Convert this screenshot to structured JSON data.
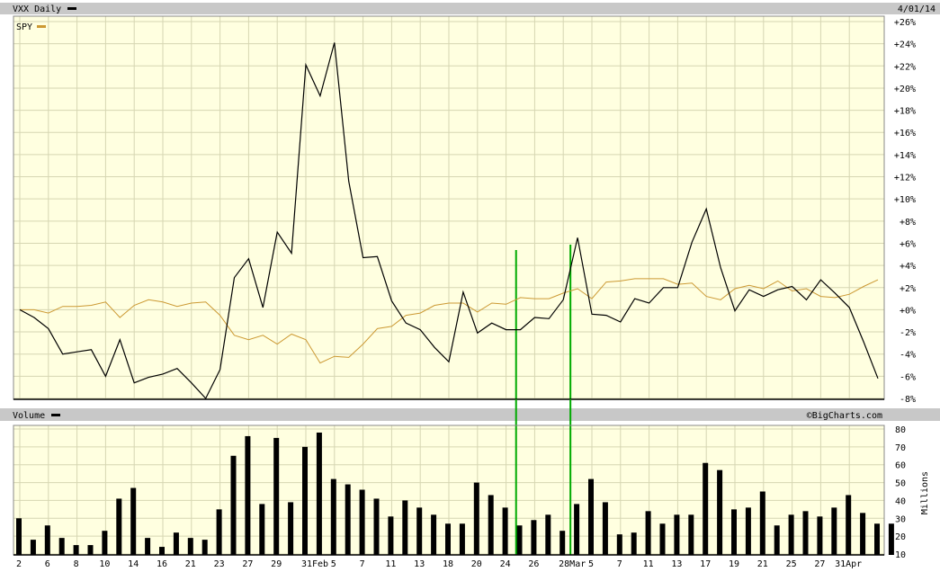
{
  "header": {
    "title": "VXX Daily",
    "date": "4/01/14",
    "legend_spy": "SPY",
    "volume_title": "Volume",
    "watermark": "©BigCharts.com",
    "volume_unit": "Millions"
  },
  "colors": {
    "plot_bg": "#ffffe0",
    "grid": "#d6d6b2",
    "header_bg": "#c8c8c8",
    "vxx_line": "#000000",
    "spy_line": "#cc9933",
    "annotation": "#00aa00",
    "volume_bar": "#000000"
  },
  "chart_data": [
    {
      "type": "line",
      "title": "VXX Daily",
      "ylim": [
        -8,
        26
      ],
      "y_ticks": [
        "+26%",
        "+24%",
        "+22%",
        "+20%",
        "+18%",
        "+16%",
        "+14%",
        "+12%",
        "+10%",
        "+8%",
        "+6%",
        "+4%",
        "+2%",
        "+0%",
        "-2%",
        "-4%",
        "-6%",
        "-8%"
      ],
      "y_tick_values": [
        26,
        24,
        22,
        20,
        18,
        16,
        14,
        12,
        10,
        8,
        6,
        4,
        2,
        0,
        -2,
        -4,
        -6,
        -8
      ],
      "x_tick_labels": [
        "2",
        "6",
        "8",
        "10",
        "14",
        "16",
        "21",
        "23",
        "27",
        "29",
        "31Feb",
        "5",
        "7",
        "11",
        "13",
        "18",
        "20",
        "24",
        "26",
        "28Mar",
        "5",
        "7",
        "11",
        "13",
        "17",
        "19",
        "21",
        "25",
        "27",
        "31Apr"
      ],
      "x_tick_index": [
        0,
        2,
        4,
        6,
        8,
        10,
        12,
        14,
        16,
        18,
        20,
        22,
        24,
        26,
        28,
        30,
        32,
        34,
        36,
        38,
        40,
        42,
        44,
        46,
        48,
        50,
        52,
        54,
        56,
        58
      ],
      "grid": true,
      "legend_placement": "top-left",
      "series": [
        {
          "name": "VXX",
          "values": [
            0,
            -0.7,
            -1.7,
            -4,
            -3.8,
            -3.6,
            -6,
            -2.7,
            -6.6,
            -6.1,
            -5.8,
            -5.3,
            -6.6,
            -8,
            -5.4,
            2.9,
            4.6,
            0.2,
            7,
            5.1,
            22.1,
            19.3,
            24.1,
            11.6,
            4.7,
            4.8,
            0.8,
            -1.2,
            -1.8,
            -3.4,
            -4.7,
            1.6,
            -2.1,
            -1.2,
            -1.8,
            -1.8,
            -0.7,
            -0.8,
            0.9,
            6.5,
            -0.4,
            -0.5,
            -1.1,
            1,
            0.6,
            2,
            2,
            6.1,
            9.1,
            3.8,
            -0.1,
            1.8,
            1.2,
            1.8,
            2.1,
            0.9,
            2.7,
            1.5,
            0.2,
            -2.9,
            -6.2
          ]
        },
        {
          "name": "SPY",
          "values": [
            0,
            0,
            -0.3,
            0.3,
            0.3,
            0.4,
            0.7,
            -0.7,
            0.4,
            0.9,
            0.7,
            0.3,
            0.6,
            0.7,
            -0.5,
            -2.3,
            -2.7,
            -2.3,
            -3.1,
            -2.2,
            -2.7,
            -4.8,
            -4.2,
            -4.3,
            -3.1,
            -1.7,
            -1.5,
            -0.5,
            -0.3,
            0.4,
            0.6,
            0.6,
            -0.2,
            0.6,
            0.5,
            1.1,
            1.0,
            1.0,
            1.5,
            1.9,
            1.0,
            2.5,
            2.6,
            2.8,
            2.8,
            2.8,
            2.3,
            2.4,
            1.2,
            0.9,
            1.9,
            2.2,
            1.9,
            2.6,
            1.7,
            1.9,
            1.2,
            1.1,
            1.4,
            2.1,
            2.7
          ]
        }
      ],
      "annotation_indices": [
        34.7,
        38.5
      ]
    },
    {
      "type": "bar",
      "title": "Volume",
      "ylabel": "Millions",
      "ylim": [
        10,
        80
      ],
      "y_ticks": [
        "80",
        "70",
        "60",
        "50",
        "40",
        "30",
        "20",
        "10"
      ],
      "y_tick_values": [
        80,
        70,
        60,
        50,
        40,
        30,
        20,
        10
      ],
      "values": [
        30,
        18,
        26,
        19,
        15,
        15,
        23,
        41,
        47,
        19,
        14,
        22,
        19,
        18,
        35,
        65,
        76,
        38,
        75,
        39,
        70,
        78,
        52,
        49,
        46,
        41,
        31,
        40,
        36,
        32,
        27,
        27,
        50,
        43,
        36,
        26,
        29,
        32,
        23,
        38,
        52,
        39,
        21,
        22,
        34,
        27,
        32,
        32,
        61,
        57,
        35,
        36,
        45,
        26,
        32,
        34,
        31,
        36,
        43,
        33,
        27,
        27
      ]
    }
  ]
}
